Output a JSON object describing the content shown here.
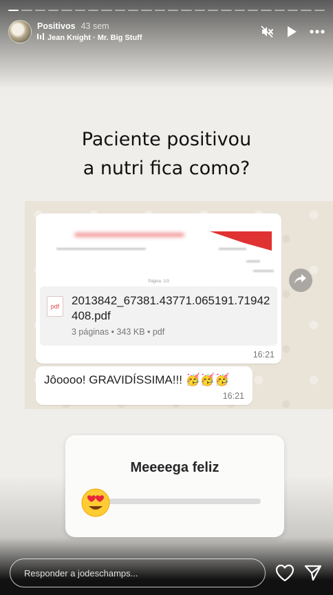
{
  "header": {
    "account_name": "Positivos",
    "post_age": "43 sem",
    "music": "Jean Knight · Mr. Big Stuff"
  },
  "story": {
    "caption_line1": "Paciente positivou",
    "caption_line2": "a nutri fica como?"
  },
  "chat": {
    "document": {
      "page_label": "Página: 1/3",
      "file_name": "2013842_67381.43771.065191.71942408.pdf",
      "meta": "3 páginas • 343 KB • pdf",
      "time": "16:21",
      "type_label": "pdf"
    },
    "message": {
      "text": "Jôoooo! GRAVIDÍSSIMA!!! 🥳🥳🥳",
      "time": "16:21"
    }
  },
  "slider_sticker": {
    "question": "Meeeega feliz",
    "emoji": "heart-eyes-face",
    "level": 0.0
  },
  "reply": {
    "placeholder": "Responder a jodeschamps..."
  },
  "colors": {
    "accent_red": "#e03232",
    "chat_bg": "#e9e3d8",
    "bubble": "#ffffff"
  },
  "progress": {
    "current": 1
  }
}
